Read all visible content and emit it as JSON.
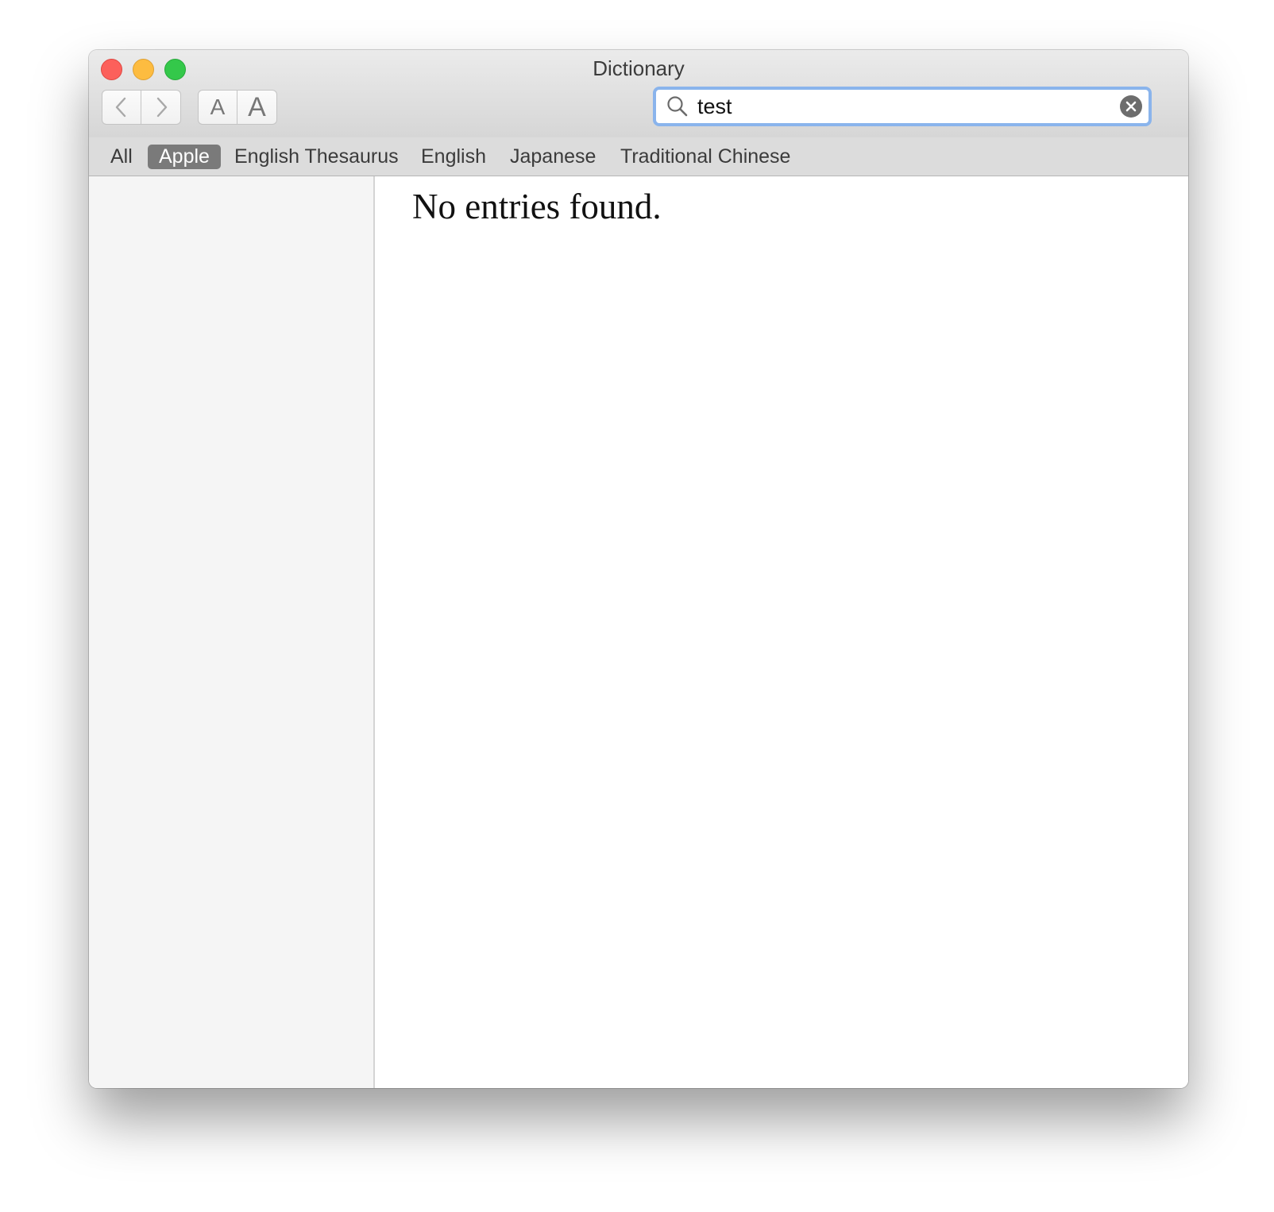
{
  "window": {
    "title": "Dictionary"
  },
  "toolbar": {
    "back_icon": "chevron-left-icon",
    "forward_icon": "chevron-right-icon",
    "font_smaller_label": "A",
    "font_larger_label": "A"
  },
  "search": {
    "value": "test",
    "search_icon": "magnifying-glass-icon",
    "clear_icon": "clear-x-icon",
    "focus_color": "#8ab4ec"
  },
  "scopes": {
    "items": [
      {
        "label": "All"
      },
      {
        "label": "Apple"
      },
      {
        "label": "English Thesaurus"
      },
      {
        "label": "English"
      },
      {
        "label": "Japanese"
      },
      {
        "label": "Traditional Chinese"
      }
    ],
    "selected": "Apple"
  },
  "content": {
    "message": "No entries found."
  },
  "colors": {
    "close": "#fc605b",
    "minimize": "#fdbc40",
    "maximize": "#34c84a",
    "scope_selected_bg": "#7a7a7a"
  }
}
